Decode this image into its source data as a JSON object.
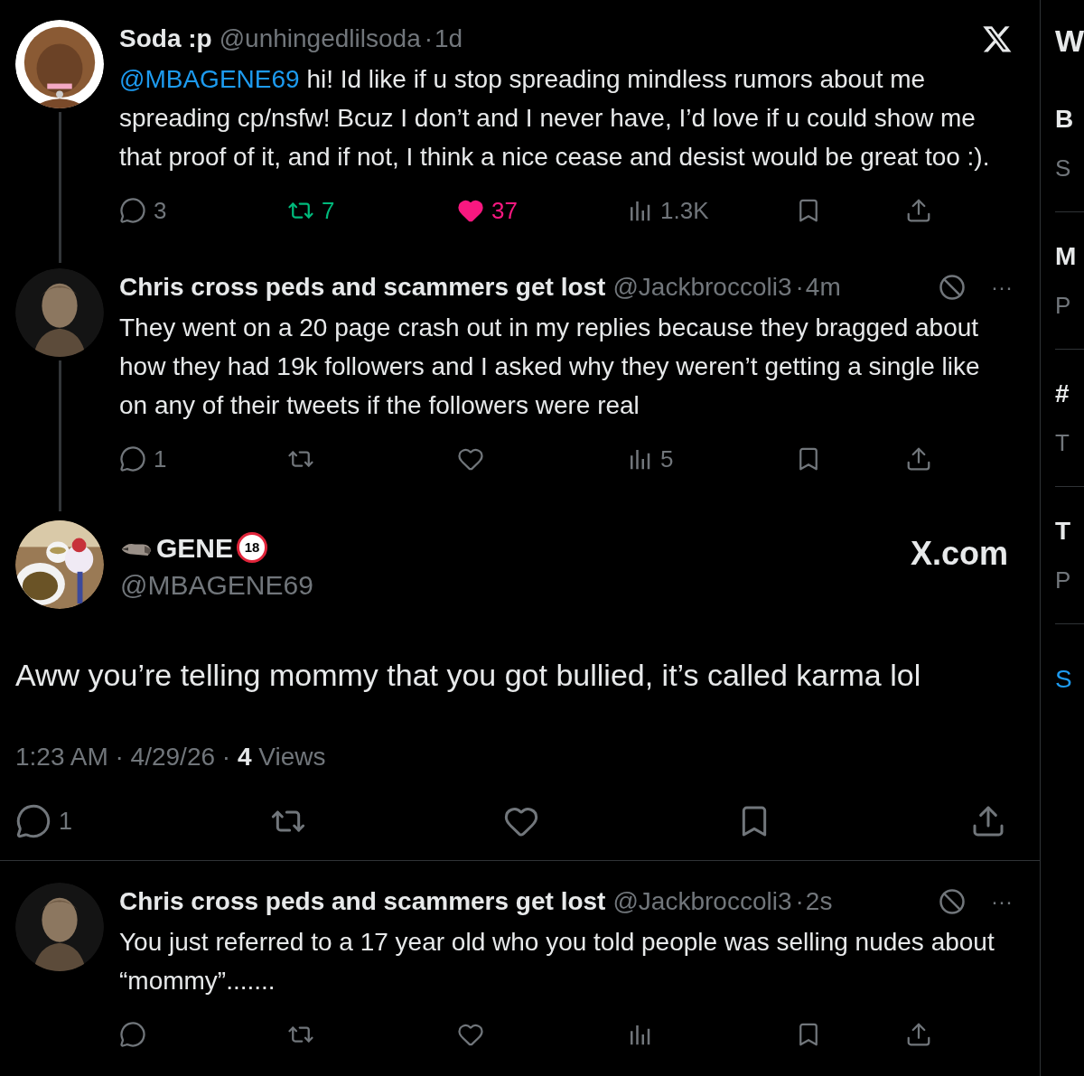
{
  "thread": [
    {
      "name": "Soda :p",
      "handle": "@unhingedlilsoda",
      "sep": "·",
      "time": "1d",
      "corner": {
        "kind": "x-logo"
      },
      "mention": "@MBAGENE69",
      "body": " hi! Id like if u stop spreading mindless rumors about me spreading cp/nsfw! Bcuz I don’t and I never have, I’d love if u could show me that proof of it, and if not, I think a nice cease and desist would be great too :).",
      "actions": [
        {
          "kind": "reply",
          "count": "3",
          "active": false
        },
        {
          "kind": "repost",
          "count": "7",
          "active": true
        },
        {
          "kind": "like",
          "count": "37",
          "active": true
        },
        {
          "kind": "views",
          "count": "1.3K",
          "active": false
        },
        {
          "kind": "bookmark",
          "active": false
        },
        {
          "kind": "share",
          "active": false
        }
      ]
    },
    {
      "name": "Chris cross peds and scammers get lost",
      "handle": "@Jackbroccoli3",
      "sep": "·",
      "time": "4m",
      "corner": {
        "kind": "grok",
        "menu": "···"
      },
      "body": "They went on a 20 page crash out in my replies because they bragged about how they had 19k followers and I asked why they weren’t getting a single like on any of their tweets if the followers were real",
      "actions": [
        {
          "kind": "reply",
          "count": "1",
          "active": false
        },
        {
          "kind": "repost",
          "active": false
        },
        {
          "kind": "like",
          "active": false
        },
        {
          "kind": "views",
          "count": "5",
          "active": false
        },
        {
          "kind": "bookmark",
          "active": false
        },
        {
          "kind": "share",
          "active": false
        }
      ]
    }
  ],
  "main": {
    "name": "GENE",
    "badge": "18",
    "handle": "@MBAGENE69",
    "source": "X.com",
    "text": "Aww you’re telling mommy that you got bullied, it’s called karma lol",
    "meta": "1:23 AM · 4/29/26 · **4** Views",
    "actions": [
      {
        "kind": "reply",
        "count": "1",
        "active": false
      },
      {
        "kind": "repost",
        "active": false
      },
      {
        "kind": "like",
        "active": false
      },
      {
        "kind": "bookmark",
        "active": false
      },
      {
        "kind": "share",
        "active": false
      }
    ]
  },
  "replies": [
    {
      "name": "Chris cross peds and scammers get lost",
      "handle": "@Jackbroccoli3",
      "sep": "·",
      "time": "2s",
      "corner": {
        "kind": "grok",
        "menu": "···"
      },
      "body": "You just referred to a 17 year old who you told people was selling nudes about “mommy”.......",
      "actions": [
        {
          "kind": "reply",
          "active": false
        },
        {
          "kind": "repost",
          "active": false
        },
        {
          "kind": "like",
          "active": false
        },
        {
          "kind": "views",
          "active": false
        },
        {
          "kind": "bookmark",
          "active": false
        },
        {
          "kind": "share",
          "active": false
        }
      ]
    }
  ],
  "sidebar": {
    "title": "W",
    "items": [
      {
        "title": "B",
        "subtitle": "S"
      },
      {
        "title": "M",
        "subtitle": "P"
      },
      {
        "title": "#",
        "subtitle": "T"
      },
      {
        "title": "T",
        "subtitle": "P"
      }
    ],
    "link": "S"
  }
}
